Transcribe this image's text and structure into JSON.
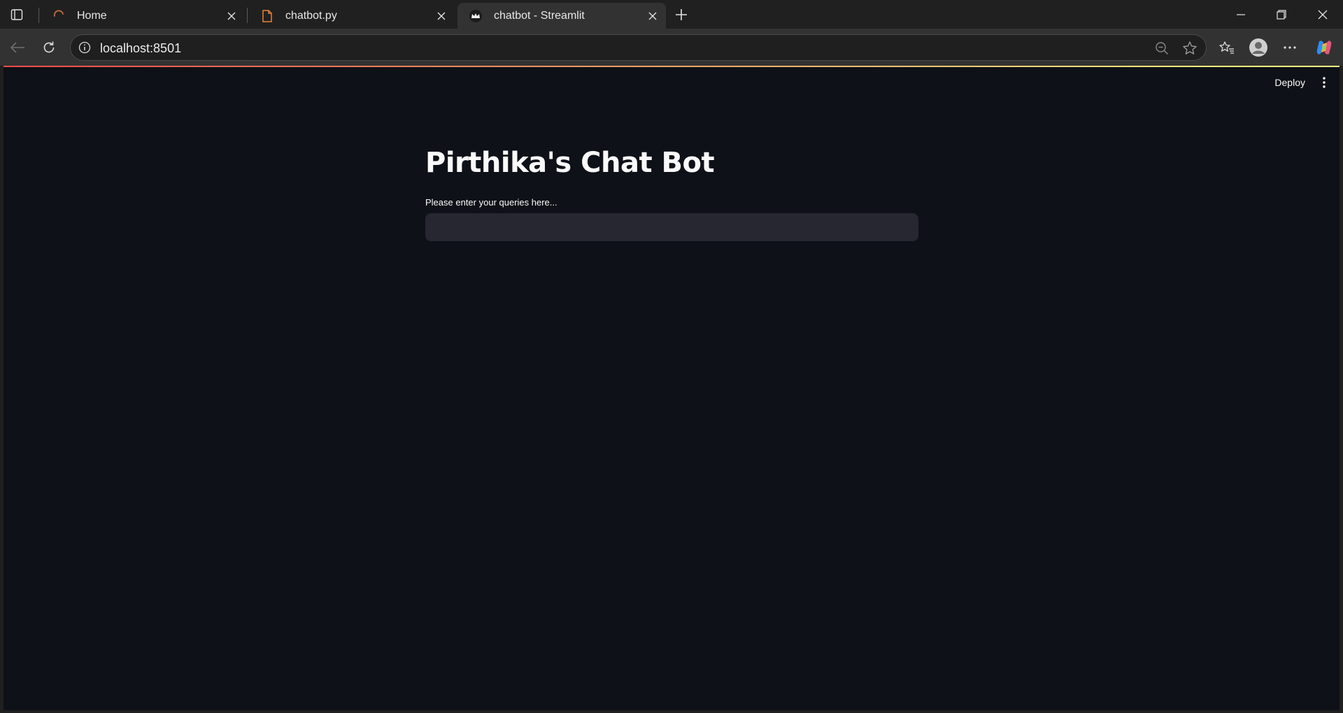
{
  "browser": {
    "tabs": [
      {
        "title": "Home",
        "icon": "loading-arc-icon"
      },
      {
        "title": "chatbot.py",
        "icon": "file-icon"
      },
      {
        "title": "chatbot - Streamlit",
        "icon": "streamlit-crown-icon",
        "active": true
      }
    ],
    "address": {
      "url": "localhost:8501"
    }
  },
  "app": {
    "deploy_label": "Deploy",
    "title": "Pirthika's Chat Bot",
    "input_label": "Please enter your queries here...",
    "input_value": ""
  },
  "colors": {
    "app_background": "#0e1117",
    "input_background": "#262730",
    "chrome_background": "#202020",
    "accent_red": "#ff4b4b",
    "accent_yellow": "#fffd80"
  }
}
